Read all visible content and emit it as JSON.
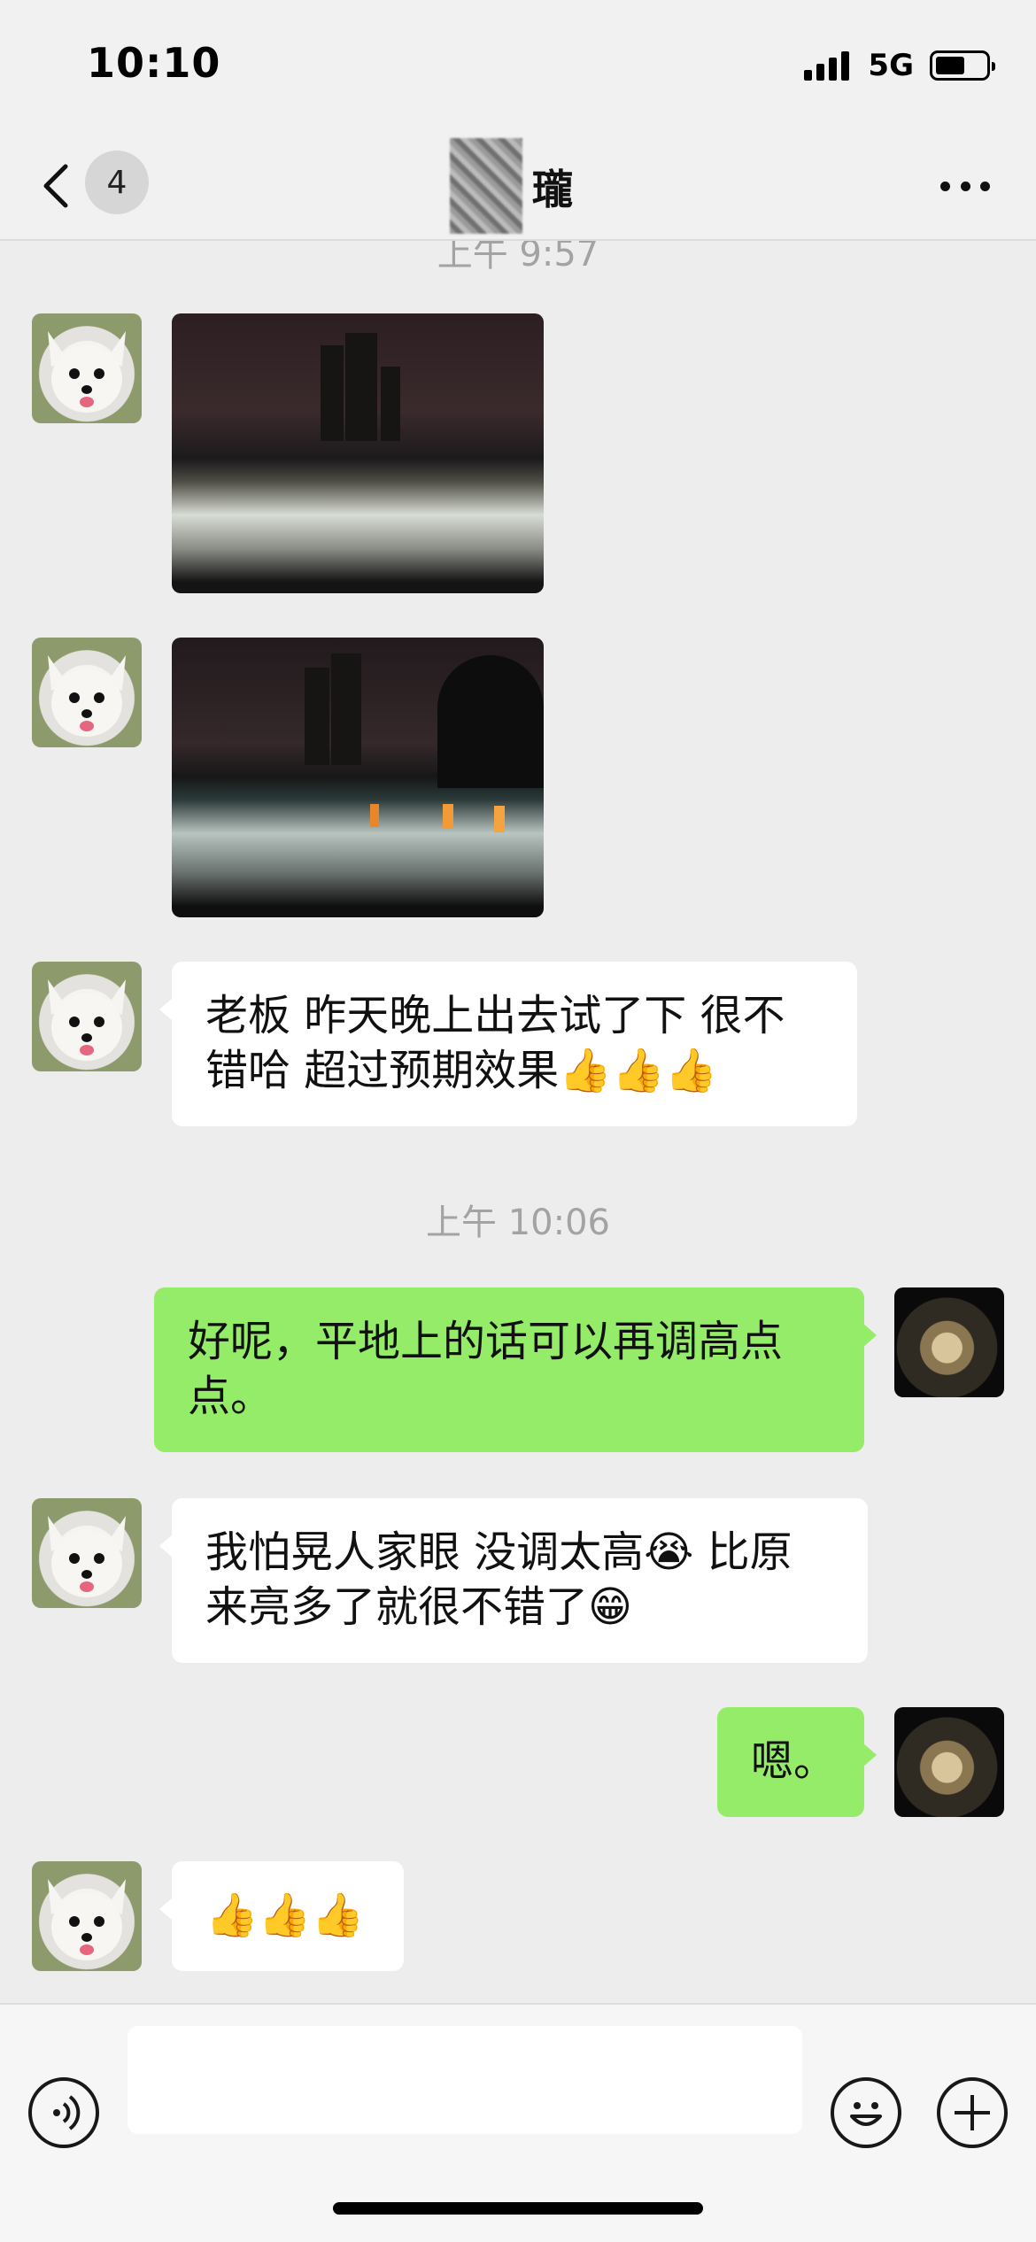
{
  "status_bar": {
    "time": "10:10",
    "network": "5G",
    "battery_level": 0.6
  },
  "nav": {
    "back_icon": "chevron-left-icon",
    "unread_count": "4",
    "title": "瓏",
    "more_icon": "ellipsis-icon"
  },
  "chat": {
    "timestamp_top": "上午 9:57",
    "timestamp_mid": "上午 10:06",
    "messages": [
      {
        "side": "left",
        "type": "image",
        "caption": ""
      },
      {
        "side": "left",
        "type": "image",
        "caption": ""
      },
      {
        "side": "left",
        "type": "text",
        "text": "老板 昨天晚上出去试了下 很不错哈 超过预期效果👍👍👍"
      },
      {
        "side": "right",
        "type": "text",
        "text": "好呢，平地上的话可以再调高点点。"
      },
      {
        "side": "left",
        "type": "text",
        "text": "我怕晃人家眼 没调太高😭 比原来亮多了就很不错了😁"
      },
      {
        "side": "right",
        "type": "text",
        "text": "嗯。"
      },
      {
        "side": "left",
        "type": "text",
        "text": "👍👍👍"
      }
    ]
  },
  "input_bar": {
    "voice_icon": "voice-icon",
    "input_value": "",
    "emoji_icon": "emoji-icon",
    "plus_icon": "plus-icon"
  },
  "colors": {
    "background": "#ededed",
    "sent_bubble": "#95ec69",
    "received_bubble": "#ffffff"
  }
}
